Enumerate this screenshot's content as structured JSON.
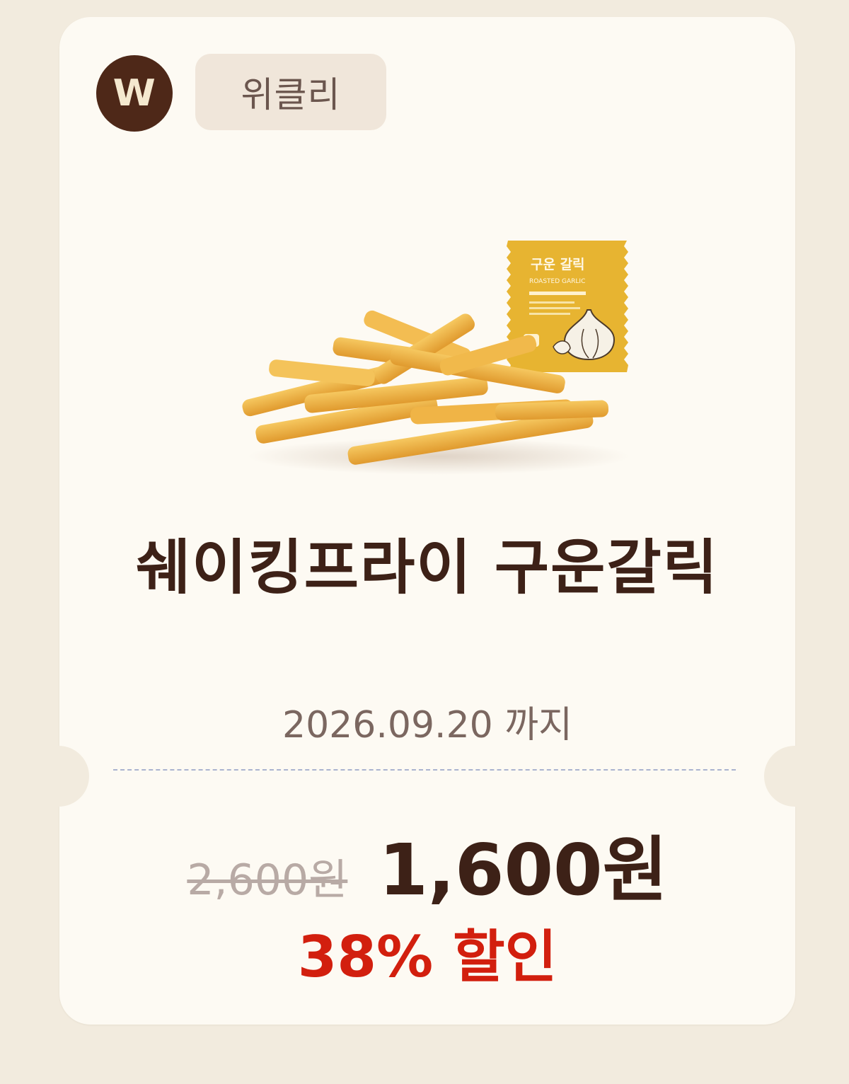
{
  "brand": {
    "logo_letter": "W"
  },
  "tag": {
    "label": "위클리"
  },
  "product": {
    "name": "쉐이킹프라이 구운갈릭",
    "sauce_packet_label": "구운 갈릭",
    "sauce_packet_sublabel": "ROASTED GARLIC"
  },
  "coupon": {
    "expiry_text": "2026.09.20 까지",
    "original_price": "2,600원",
    "sale_price": "1,600원",
    "discount_text": "38% 할인"
  },
  "colors": {
    "background": "#f2ebde",
    "card": "#fdfaf3",
    "brand_brown": "#4e2818",
    "discount_red": "#d21f0e"
  }
}
